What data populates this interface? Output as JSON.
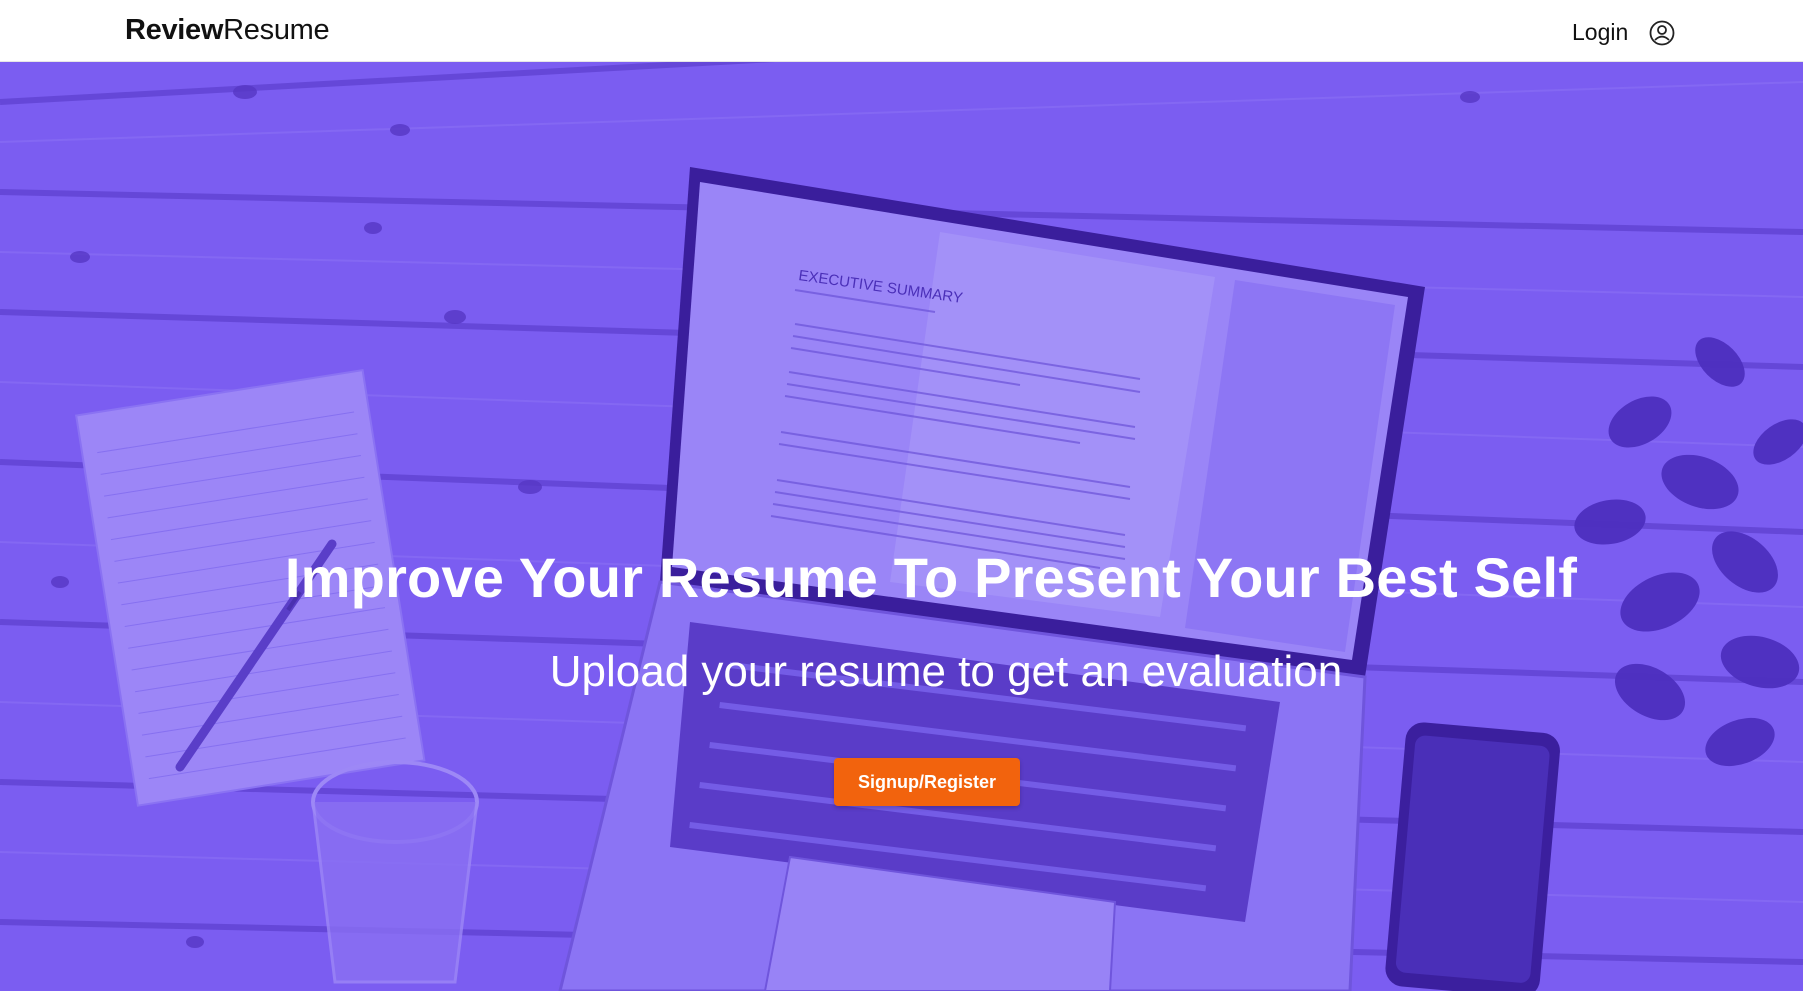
{
  "brand": {
    "bold": "Review",
    "light": "Resume"
  },
  "nav": {
    "login_label": "Login",
    "account_icon": "user-circle-icon"
  },
  "hero": {
    "title": "Improve Your Resume To Present Your Best Self",
    "subtitle": "Upload your resume to get an evaluation",
    "cta_label": "Signup/Register",
    "overlay_color": "#7a5cf0",
    "cta_color": "#f2630d",
    "screen_heading": "EXECUTIVE SUMMARY"
  }
}
